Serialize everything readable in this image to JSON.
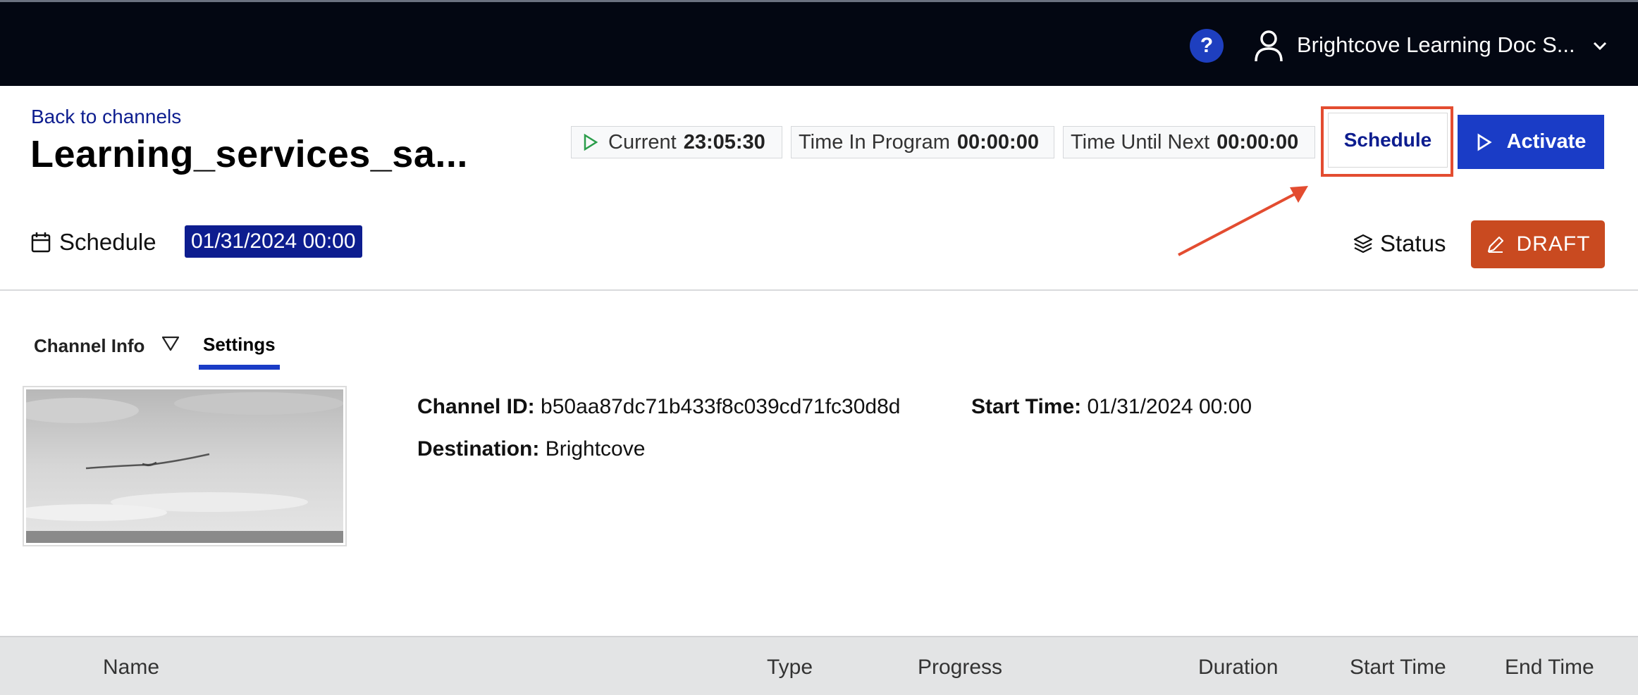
{
  "topbar": {
    "help_label": "?",
    "account_name": "Brightcove Learning Doc S...",
    "icons": {
      "help": "question-circle-icon",
      "user": "user-icon",
      "dropdown": "chevron-down-icon"
    }
  },
  "header": {
    "back_link": "Back to channels",
    "title": "Learning_services_sa..."
  },
  "stats": {
    "current_label": "Current",
    "current_value": "23:05:30",
    "program_label": "Time In Program",
    "program_value": "00:00:00",
    "next_label": "Time Until Next",
    "next_value": "00:00:00"
  },
  "actions": {
    "schedule_label": "Schedule",
    "activate_label": "Activate"
  },
  "schedule": {
    "label": "Schedule",
    "date": "01/31/2024 00:00"
  },
  "status": {
    "label": "Status",
    "draft_label": "DRAFT"
  },
  "tabs": [
    {
      "label": "Channel Info",
      "active": false
    },
    {
      "label": "Settings",
      "active": true
    }
  ],
  "info": {
    "channel_id_label": "Channel ID:",
    "channel_id_value": "b50aa87dc71b433f8c039cd71fc30d8d",
    "start_time_label": "Start Time:",
    "start_time_value": "01/31/2024 00:00",
    "destination_label": "Destination:",
    "destination_value": "Brightcove"
  },
  "table": {
    "columns": [
      "Name",
      "Type",
      "Progress",
      "Duration",
      "Start Time",
      "End Time"
    ]
  },
  "colors": {
    "topbar_bg": "#030712",
    "primary": "#1a3cc6",
    "link": "#0d1d8f",
    "draft": "#c94a20",
    "annotation": "#e34c30"
  }
}
